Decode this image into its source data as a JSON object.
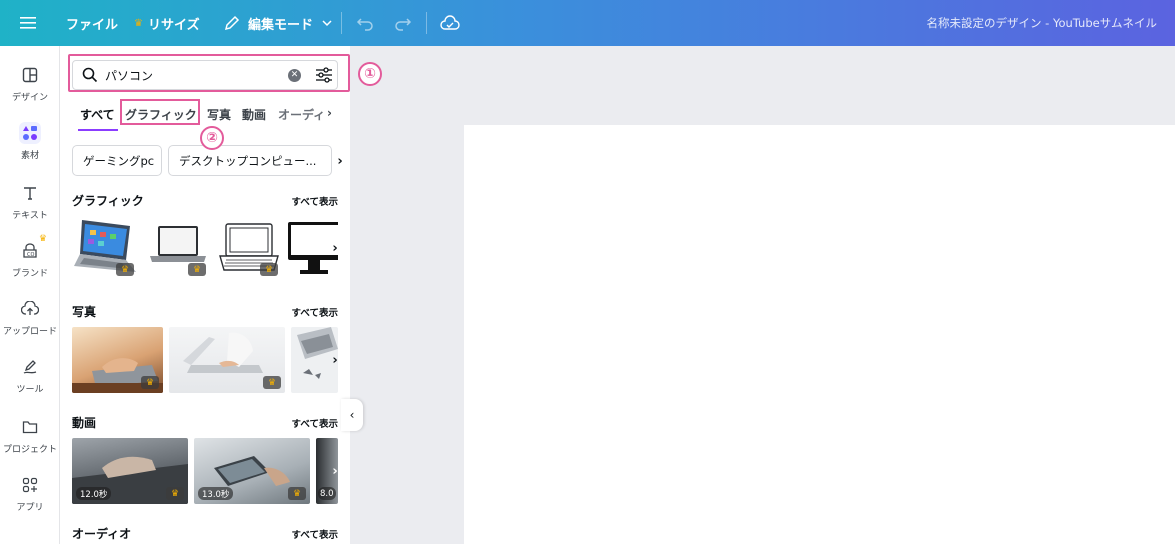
{
  "topbar": {
    "file_label": "ファイル",
    "resize_label": "リサイズ",
    "edit_mode_label": "編集モード",
    "doc_title": "名称未設定のデザイン - YouTubeサムネイル"
  },
  "rail": {
    "items": [
      {
        "label": "デザイン"
      },
      {
        "label": "素材"
      },
      {
        "label": "テキスト"
      },
      {
        "label": "ブランド"
      },
      {
        "label": "アップロード"
      },
      {
        "label": "ツール"
      },
      {
        "label": "プロジェクト"
      },
      {
        "label": "アプリ"
      }
    ]
  },
  "search": {
    "value": "パソコン"
  },
  "annotations": {
    "one": "①",
    "two": "②"
  },
  "tabs": [
    {
      "label": "すべて"
    },
    {
      "label": "グラフィック"
    },
    {
      "label": "写真"
    },
    {
      "label": "動画"
    },
    {
      "label": "オーディ"
    }
  ],
  "chips": [
    {
      "label": "ゲーミングpc"
    },
    {
      "label": "デスクトップコンピュー..."
    }
  ],
  "sections": {
    "graphics": {
      "title": "グラフィック",
      "see_all": "すべて表示"
    },
    "photos": {
      "title": "写真",
      "see_all": "すべて表示"
    },
    "videos": {
      "title": "動画",
      "see_all": "すべて表示",
      "durations": [
        "12.0秒",
        "13.0秒",
        "8.0"
      ]
    },
    "audio": {
      "title": "オーディオ",
      "see_all": "すべて表示"
    }
  },
  "colors": {
    "accent": "#8b3dff",
    "highlight": "#e35b9b",
    "crown": "#f6b100"
  }
}
